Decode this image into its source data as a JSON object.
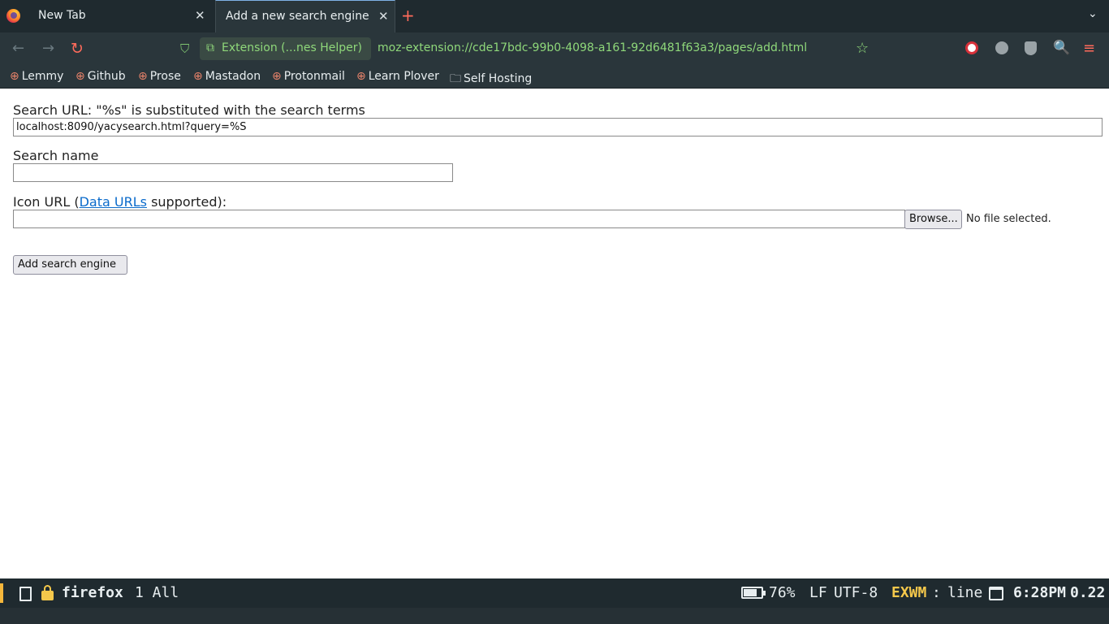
{
  "browser": {
    "tabs": [
      {
        "label": "New Tab",
        "active": false
      },
      {
        "label": "Add a new search engine",
        "active": true
      }
    ],
    "close_glyph": "✕",
    "new_tab_glyph": "+",
    "tab_list_glyph": "⌄",
    "nav": {
      "back_glyph": "←",
      "forward_glyph": "→",
      "reload_glyph": "↻",
      "shield_glyph": "⛉",
      "extension_label": "Extension (...nes Helper)",
      "url": "moz-extension://cde17bdc-99b0-4098-a161-92d6481f63a3/pages/add.html",
      "star_glyph": "☆",
      "menu_glyph": "≡",
      "search_glyph": "🔍"
    },
    "bookmarks": [
      {
        "label": "Lemmy",
        "icon": "globe-icon"
      },
      {
        "label": "Github",
        "icon": "globe-icon"
      },
      {
        "label": "Prose",
        "icon": "globe-icon"
      },
      {
        "label": "Mastadon",
        "icon": "globe-icon"
      },
      {
        "label": "Protonmail",
        "icon": "globe-icon"
      },
      {
        "label": "Learn Plover",
        "icon": "globe-icon"
      },
      {
        "label": "Self Hosting",
        "icon": "folder-icon"
      }
    ],
    "globe_glyph": "⊕",
    "folder_glyph": "🗀"
  },
  "form": {
    "search_url_label": "Search URL: \"%s\" is substituted with the search terms",
    "search_url_value": "localhost:8090/yacysearch.html?query=%S",
    "search_name_label": "Search name",
    "search_name_value": "",
    "icon_url_label_prefix": "Icon URL (",
    "icon_url_link": "Data URLs",
    "icon_url_label_suffix": " supported):",
    "icon_url_value": "",
    "browse_label": "Browse...",
    "no_file_text": "No  file  selected.",
    "submit_label": "Add  search  engine"
  },
  "modeline": {
    "buffer_name": "firefox",
    "workspace": "1 All",
    "battery": "76%",
    "battery_level": 0.76,
    "eol": "LF",
    "encoding": "UTF-8",
    "mode": "EXWM",
    "separator": ":",
    "submode": "line",
    "time": "6:28PM",
    "load": "0.22"
  },
  "colors": {
    "accent_orange": "#ff6b5b",
    "url_green": "#8fd87a",
    "mode_yellow": "#f5c84b",
    "link_blue": "#0b6bcb"
  }
}
